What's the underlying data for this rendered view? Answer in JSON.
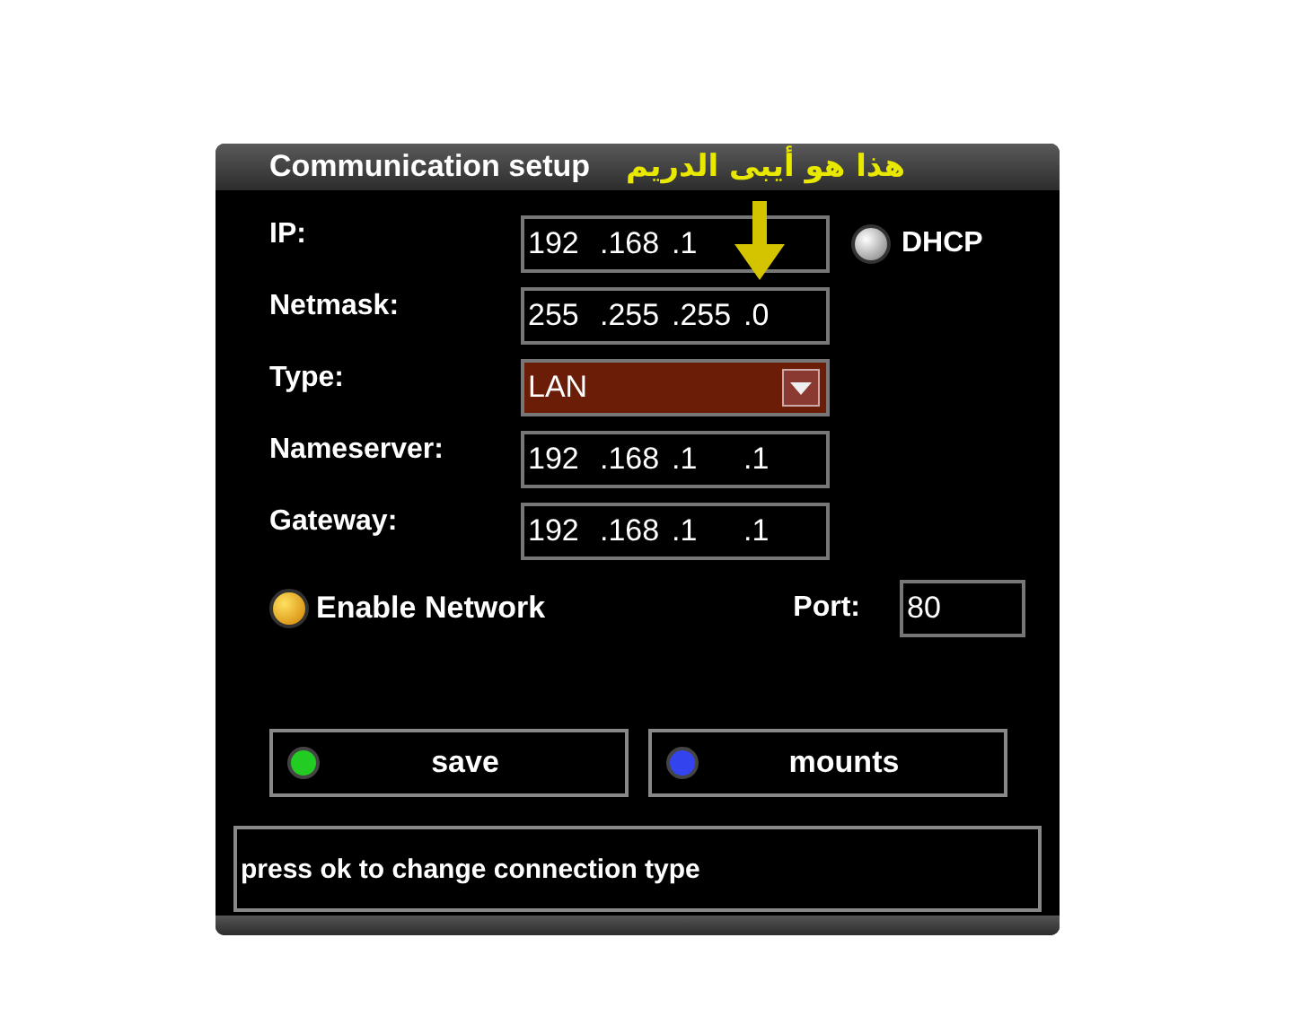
{
  "window": {
    "title": "Communication setup"
  },
  "annotation": {
    "text": "هذا هو أيبى الدريم"
  },
  "fields": [
    {
      "label": "IP:",
      "octets": [
        "192",
        ".168",
        ".1"
      ],
      "kind": "text"
    },
    {
      "label": "Netmask:",
      "octets": [
        "255",
        ".255",
        ".255",
        ".0"
      ],
      "kind": "text"
    },
    {
      "label": "Type:",
      "octets": [
        "LAN"
      ],
      "kind": "select"
    },
    {
      "label": "Nameserver:",
      "octets": [
        "192",
        ".168",
        ".1",
        ".1"
      ],
      "kind": "text"
    },
    {
      "label": "Gateway:",
      "octets": [
        "192",
        ".168",
        ".1",
        ".1"
      ],
      "kind": "text"
    }
  ],
  "dhcp": {
    "label": "DHCP",
    "on": false
  },
  "enable_network": {
    "label": "Enable Network",
    "on": true
  },
  "port": {
    "label": "Port:",
    "value": "80"
  },
  "buttons": [
    {
      "label": "save",
      "color": "#22cc22"
    },
    {
      "label": "mounts",
      "color": "#3344ee"
    }
  ],
  "status_bar": {
    "text": "press ok to change connection type"
  }
}
